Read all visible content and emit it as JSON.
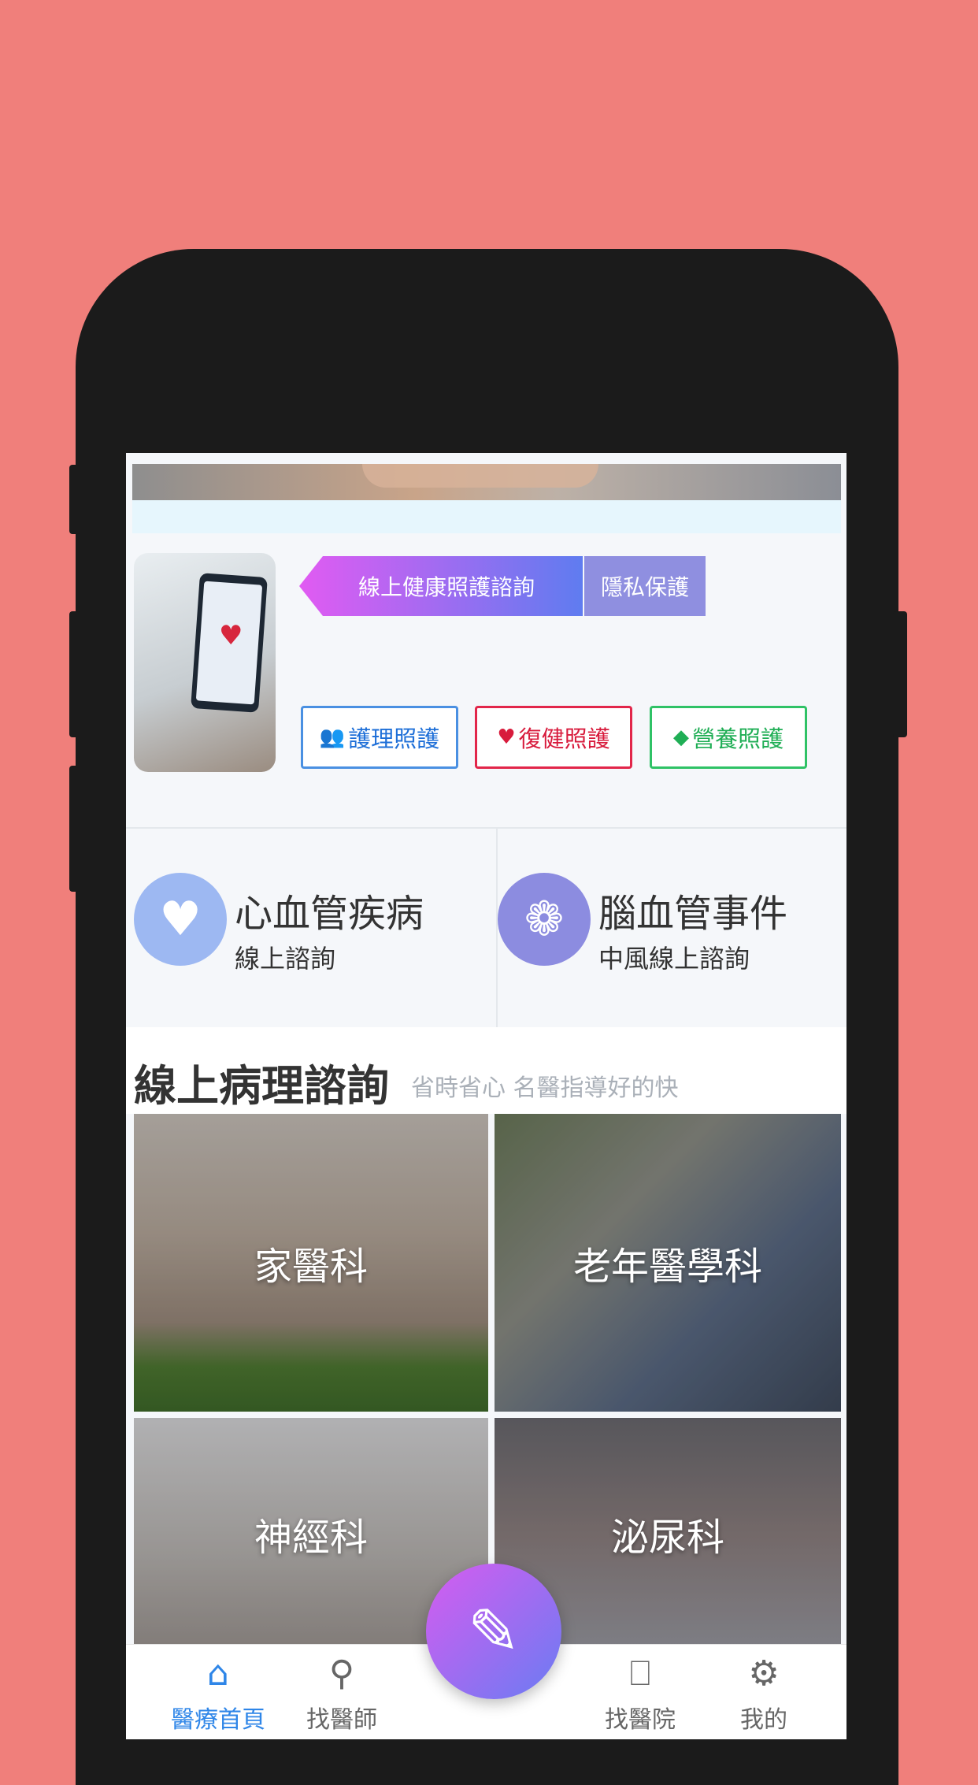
{
  "banner": {
    "ribbon_label": "線上健康照護諮詢",
    "privacy_label": "隱私保護"
  },
  "tags": [
    {
      "label": "護理照護",
      "icon": "user-icon",
      "color": "#1E6FD8"
    },
    {
      "label": "復健照護",
      "icon": "heart-icon",
      "color": "#D81B3C"
    },
    {
      "label": "營養照護",
      "icon": "gem-icon",
      "color": "#1FAE55"
    }
  ],
  "features": [
    {
      "title": "心血管疾病",
      "subtitle": "線上諮詢",
      "icon": "heart-icon",
      "color": "#9DB8F2"
    },
    {
      "title": "腦血管事件",
      "subtitle": "中風線上諮詢",
      "icon": "flower-icon",
      "color": "#8C8CE0"
    }
  ],
  "section": {
    "title": "線上病理諮詢",
    "subtitle": "省時省心 名醫指導好的快"
  },
  "departments": [
    "家醫科",
    "老年醫學科",
    "神經科",
    "泌尿科"
  ],
  "fab": {
    "icon": "pencil-icon"
  },
  "nav": {
    "active": 0,
    "items": [
      {
        "label": "醫療首頁",
        "icon": "home-icon"
      },
      {
        "label": "找醫師",
        "icon": "search-icon"
      },
      {
        "label": "找醫院",
        "icon": "bookmark-icon"
      },
      {
        "label": "我的",
        "icon": "settings-icon"
      }
    ]
  },
  "colors": {
    "background": "#F07F7B",
    "accent": "#2F86E8",
    "gradient_start": "#E15BF2",
    "gradient_end": "#5F7CF0"
  }
}
